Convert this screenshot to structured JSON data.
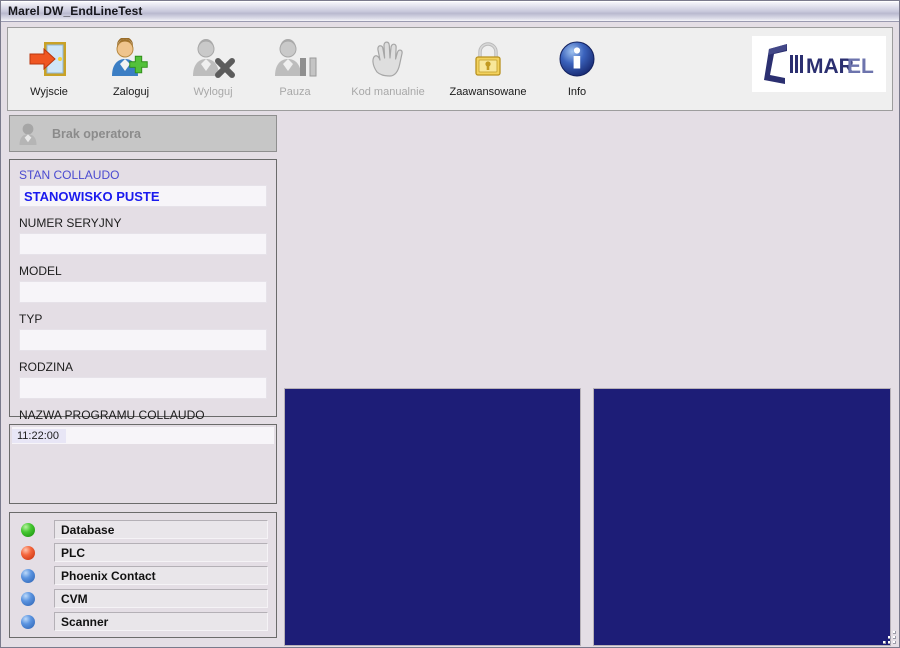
{
  "window": {
    "title": "Marel DW_EndLineTest"
  },
  "toolbar": {
    "buttons": [
      {
        "label": "Wyjscie",
        "icon": "exit-door-icon",
        "enabled": true
      },
      {
        "label": "Zaloguj",
        "icon": "user-add-icon",
        "enabled": true
      },
      {
        "label": "Wyloguj",
        "icon": "user-remove-icon",
        "enabled": false
      },
      {
        "label": "Pauza",
        "icon": "user-pause-icon",
        "enabled": false
      },
      {
        "label": "Kod manualnie",
        "icon": "hand-icon",
        "enabled": false
      },
      {
        "label": "Zaawansowane",
        "icon": "lock-icon",
        "enabled": true
      },
      {
        "label": "Info",
        "icon": "info-icon",
        "enabled": true
      }
    ],
    "logo_text": "MAREL",
    "logo_name": "marel-logo"
  },
  "operator": {
    "icon": "user-silhouette-icon",
    "label": "Brak operatora"
  },
  "info_panel": {
    "state_label": "STAN COLLAUDO",
    "state_value": "STANOWISKO PUSTE",
    "fields": [
      {
        "label": "NUMER SERYJNY",
        "value": ""
      },
      {
        "label": "MODEL",
        "value": ""
      },
      {
        "label": "TYP",
        "value": ""
      },
      {
        "label": "RODZINA",
        "value": ""
      },
      {
        "label": "NAZWA PROGRAMU COLLAUDO",
        "value": ""
      }
    ]
  },
  "log_panel": {
    "entries": [
      {
        "time": "11:22:00",
        "message": ""
      }
    ]
  },
  "status_panel": {
    "items": [
      {
        "name": "Database",
        "led": "green"
      },
      {
        "name": "PLC",
        "led": "red"
      },
      {
        "name": "Phoenix Contact",
        "led": "blue"
      },
      {
        "name": "CVM",
        "led": "blue"
      },
      {
        "name": "Scanner",
        "led": "blue"
      }
    ]
  },
  "display_panels": {
    "left": {
      "name": "display-panel-left",
      "content": ""
    },
    "right": {
      "name": "display-panel-right",
      "content": ""
    }
  },
  "colors": {
    "window_background": "#e4dee5",
    "panel_blue": "#1d1d77",
    "accent_blue": "#4a4ad0",
    "led_green": "#46c832",
    "led_red": "#f4663c",
    "led_blue": "#5b94e0"
  }
}
